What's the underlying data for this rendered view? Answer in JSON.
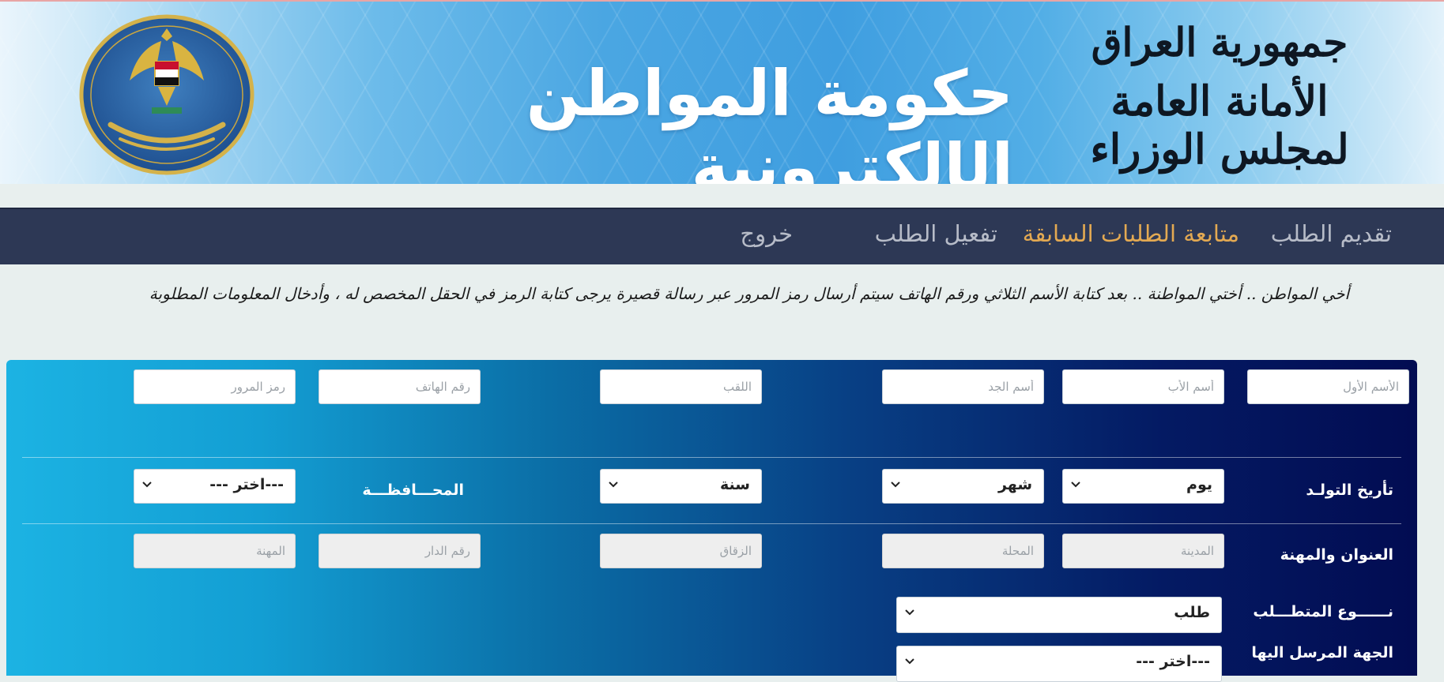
{
  "header": {
    "title": "حكومة المواطن الإلكترونية",
    "republic_line1": "جمهورية العراق",
    "republic_line2": "الأمانة العامة لمجلس الوزراء"
  },
  "nav": {
    "items": [
      {
        "label": "تقديم الطلب",
        "active": false
      },
      {
        "label": "متابعة الطلبات السابقة",
        "active": true
      },
      {
        "label": "تفعيل الطلب",
        "active": false
      },
      {
        "label": "خروج",
        "active": false
      }
    ]
  },
  "instructions": "أخي المواطن .. أختي المواطنة .. بعد كتابة الأسم الثلاثي ورقم الهاتف سيتم أرسال رمز المرور عبر رسالة قصيرة يرجى كتابة الرمز في الحقل المخصص له ، وأدخال المعلومات المطلوبة",
  "form": {
    "name_row": {
      "first_name_placeholder": "الأسم الأول",
      "father_name_placeholder": "أسم الأب",
      "grandfather_name_placeholder": "أسم الجد",
      "surname_placeholder": "اللقب",
      "phone_placeholder": "رقم الهاتف",
      "password_placeholder": "رمز المرور"
    },
    "birth_row": {
      "label": "تأريخ التولـد",
      "day_value": "يوم",
      "month_value": "شهر",
      "year_value": "سنة",
      "governorate_label": "المحـــافظـــة",
      "governorate_value": "---اختر ---"
    },
    "address_row": {
      "label": "العنوان والمهنة",
      "city_placeholder": "المدينة",
      "district_placeholder": "المحلة",
      "alley_placeholder": "الزقاق",
      "house_placeholder": "رقم الدار",
      "profession_placeholder": "المهنة"
    },
    "request_type": {
      "label": "نــــــوع المتطـــلب",
      "value": "طلب"
    },
    "recipient": {
      "label": "الجهة المرسل اليها",
      "value": "---اختر ---"
    }
  },
  "colors": {
    "nav_bg": "#2d3855",
    "nav_active": "#e3a952",
    "nav_text": "#b7bcc8",
    "panel_dark": "#020c52",
    "panel_light": "#1cb3e3"
  }
}
